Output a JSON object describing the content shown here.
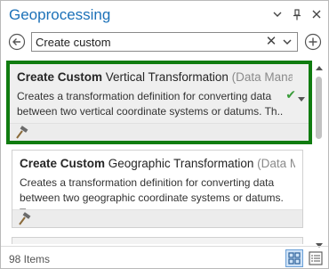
{
  "pane": {
    "title": "Geoprocessing"
  },
  "search": {
    "value": "Create custom"
  },
  "results": [
    {
      "title_bold": "Create Custom",
      "title_rest": " Vertical Transformation",
      "toolbox": " (Data Mana...",
      "description": "Creates a transformation definition for converting data between two vertical coordinate systems or datums. Th..",
      "selected": true
    },
    {
      "title_bold": "Create Custom",
      "title_rest": " Geographic Transformation",
      "toolbox": " (Data Mana...",
      "description": "Creates a transformation definition for converting data between two geographic coordinate systems or datums. T...",
      "selected": false
    }
  ],
  "status": {
    "count": "98 Items"
  },
  "colors": {
    "title": "#1c71b8",
    "selection_border": "#107c10",
    "check": "#3a9c3a"
  },
  "icons": {
    "title_bar": [
      "chevron-down-icon",
      "pin-icon",
      "close-icon"
    ],
    "nav": [
      "back-arrow-icon",
      "clear-icon",
      "dropdown-icon",
      "add-icon"
    ],
    "card": [
      "hammer-icon",
      "checkmark-icon"
    ],
    "status": [
      "tile-view-icon",
      "list-view-icon"
    ]
  }
}
